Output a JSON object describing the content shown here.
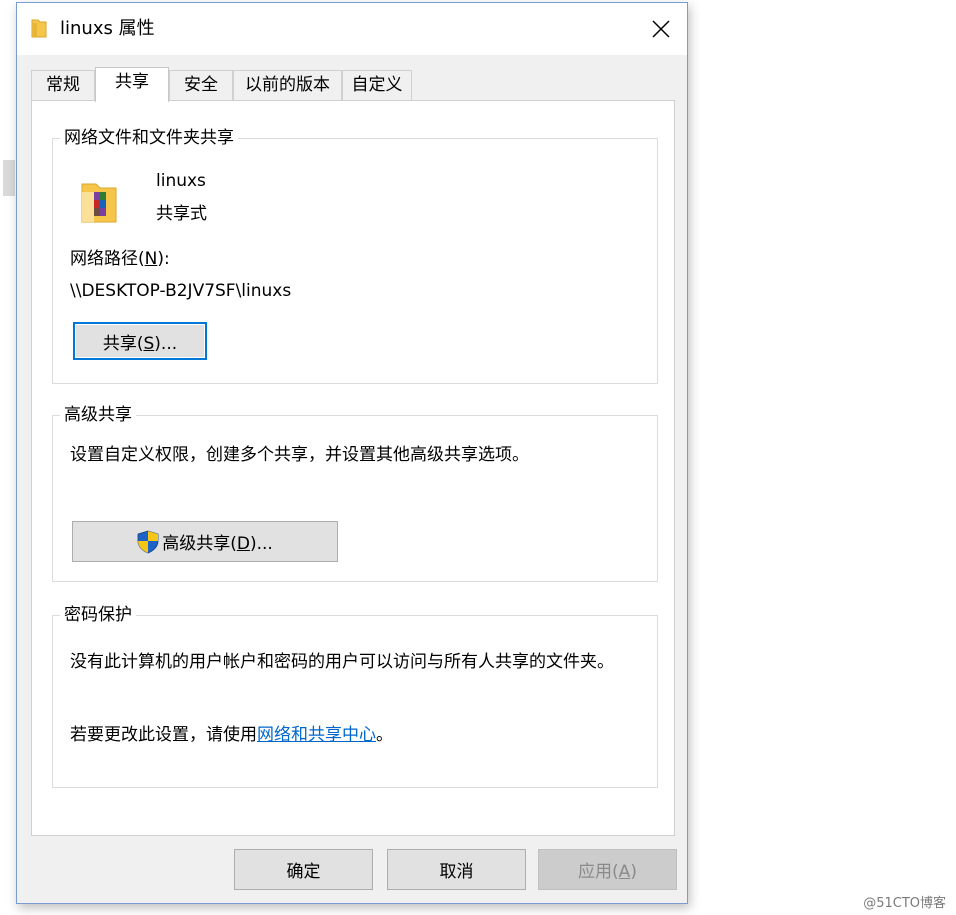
{
  "window": {
    "title": "linuxs 属性",
    "close_glyph": "✕"
  },
  "tabs": [
    {
      "label": "常规",
      "active": false
    },
    {
      "label": "共享",
      "active": true
    },
    {
      "label": "安全",
      "active": false
    },
    {
      "label": "以前的版本",
      "active": false
    },
    {
      "label": "自定义",
      "active": false
    }
  ],
  "network_share": {
    "group_title": "网络文件和文件夹共享",
    "folder_name": "linuxs",
    "folder_status": "共享式",
    "path_label": "网络路径",
    "path_mnemonic": "N",
    "path_value": "\\\\DESKTOP-B2JV7SF\\linuxs",
    "share_button": {
      "text": "共享",
      "mnemonic": "S",
      "suffix": "..."
    }
  },
  "advanced_share": {
    "group_title": "高级共享",
    "description": "设置自定义权限，创建多个共享，并设置其他高级共享选项。",
    "button": {
      "text": "高级共享",
      "mnemonic": "D",
      "suffix": "..."
    }
  },
  "password_protection": {
    "group_title": "密码保护",
    "description": "没有此计算机的用户帐户和密码的用户可以访问与所有人共享的文件夹。",
    "change_prefix": "若要更改此设置，请使用",
    "change_link": "网络和共享中心",
    "change_suffix": "。"
  },
  "footer": {
    "ok": "确定",
    "cancel": "取消",
    "apply_text": "应用",
    "apply_mnemonic": "A"
  },
  "watermark": "@51CTO博客",
  "colors": {
    "accent": "#0078d7",
    "link": "#0066cc",
    "folder": "#f6c64b",
    "shield_blue": "#1e63c8",
    "shield_yellow": "#f5c518"
  }
}
